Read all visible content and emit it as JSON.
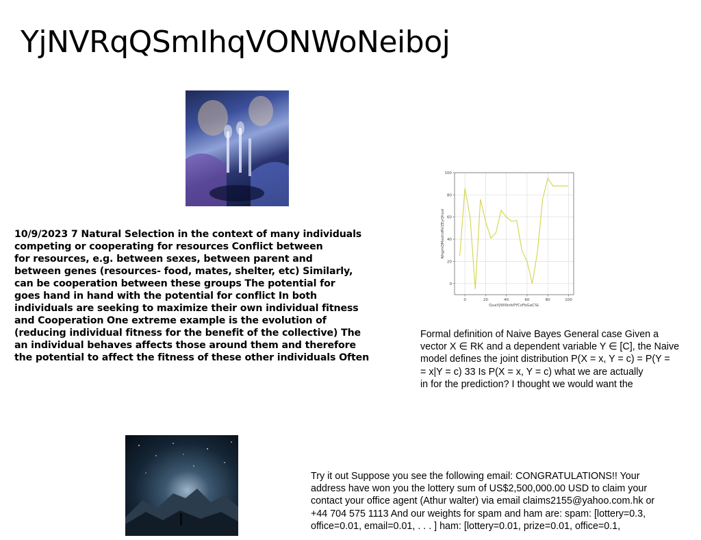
{
  "page": {
    "title": "YjNVRqQSmIhqVONWoNeiboj"
  },
  "images": {
    "party_photo": {
      "alt": "people toasting champagne glasses in blue light"
    },
    "mountain_photo": {
      "alt": "person under starry sky in front of mountains"
    }
  },
  "blocks": {
    "natural_selection": [
      "10/9/2023 7 Natural Selection in the context of many individuals",
      "competing or cooperating for resources Conflict between",
      "for resources, e.g. between sexes, between parent and",
      "between genes (resources- food, mates, shelter, etc) Similarly,",
      "can be cooperation between these groups The potential for",
      "goes hand in hand with the potential for conflict In both",
      "individuals are seeking to maximize their own individual fitness",
      "and Cooperation One extreme example is the evolution of",
      "(reducing individual fitness for the benefit of the collective) The",
      "an individual behaves affects those around them and therefore",
      "the potential to affect the fitness of these other individuals Often"
    ],
    "naive_bayes": [
      "Formal definition of Naive Bayes General case Given a",
      "vector X ∈ RK and a dependent variable Y ∈ [C], the Naive",
      "model defines the joint distribution P(X = x, Y = c) = P(Y =",
      "= x|Y = c) 33 Is P(X = x, Y = c) what we are actually",
      "in for the prediction? I thought we would want the"
    ],
    "spam": [
      "Try it out Suppose you see the following email: CONGRATULATIONS!! Your",
      "address have won you the lottery sum of US$2,500,000.00 USD to claim your",
      "contact your office agent (Athur walter) via email claims2155@yahoo.com.hk or",
      "+44 704 575 1113 And our weights for spam and ham are: spam: [lottery=0.3,",
      "office=0.01, email=0.01, . . . ] ham: [lottery=0.01, prize=0.01, office=0.1,"
    ]
  },
  "chart_data": {
    "type": "line",
    "xlabel": "QuaYJWXbrbPYCsFbGaCSL",
    "ylabel": "NhgmQMezlrzRVZEyQhsxl",
    "xlim": [
      -10,
      105
    ],
    "ylim": [
      -10,
      100
    ],
    "xticks": [
      0,
      20,
      40,
      60,
      80,
      100
    ],
    "yticks": [
      0,
      20,
      40,
      60,
      80,
      100
    ],
    "grid": true,
    "line_color": "#d4d44a",
    "series": [
      {
        "x": [
          -5,
          0,
          5,
          10,
          15,
          20,
          25,
          30,
          35,
          40,
          45,
          50,
          55,
          60,
          65,
          70,
          75,
          80,
          85,
          90,
          95,
          100
        ],
        "y": [
          25,
          86,
          60,
          -5,
          76,
          56,
          41,
          46,
          66,
          60,
          56,
          57,
          30,
          20,
          0,
          28,
          76,
          95,
          88,
          88,
          88,
          88
        ]
      }
    ]
  }
}
